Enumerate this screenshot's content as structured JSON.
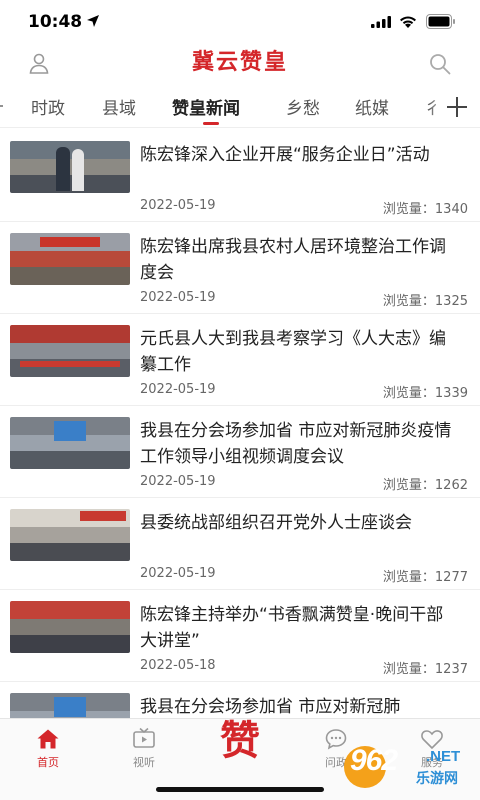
{
  "status_bar": {
    "time": "10:48"
  },
  "header": {
    "title": "冀云赞皇"
  },
  "tabs": [
    {
      "label": "时政",
      "active": false
    },
    {
      "label": "县域",
      "active": false
    },
    {
      "label": "赞皇新闻",
      "active": true
    },
    {
      "label": "乡愁",
      "active": false
    },
    {
      "label": "纸媒",
      "active": false
    },
    {
      "label": "彳",
      "active": false
    }
  ],
  "news": [
    {
      "title": "陈宏锋深入企业开展“服务企业日”活动",
      "date": "2022-05-19",
      "views": "浏览量：1340"
    },
    {
      "title": "陈宏锋出席我县农村人居环境整治工作调度会",
      "date": "2022-05-19",
      "views": "浏览量：1325"
    },
    {
      "title": "元氏县人大到我县考察学习《人大志》编纂工作",
      "date": "2022-05-19",
      "views": "浏览量：1339"
    },
    {
      "title": "我县在分会场参加省 市应对新冠肺炎疫情工作领导小组视频调度会议",
      "date": "2022-05-19",
      "views": "浏览量：1262"
    },
    {
      "title": "县委统战部组织召开党外人士座谈会",
      "date": "2022-05-19",
      "views": "浏览量：1277"
    },
    {
      "title": "陈宏锋主持举办“书香飘满赞皇·晚间干部大讲堂”",
      "date": "2022-05-18",
      "views": "浏览量：1237"
    },
    {
      "title": "我县在分会场参加省 市应对新冠肺",
      "date": "",
      "views": ""
    }
  ],
  "tab_bar": {
    "items": [
      {
        "label": "首页",
        "icon": "home-icon",
        "active": true
      },
      {
        "label": "视听",
        "icon": "tv-icon",
        "active": false
      },
      {
        "label": "赞",
        "icon": "logo",
        "active": false
      },
      {
        "label": "问政",
        "icon": "chat-icon",
        "active": false
      },
      {
        "label": "服务",
        "icon": "heart-icon",
        "active": false
      }
    ]
  },
  "watermark": {
    "number": "962",
    "domain": ".NET",
    "name": "乐游网"
  },
  "colors": {
    "accent": "#d4262a",
    "text": "#222222",
    "muted": "#666666"
  }
}
